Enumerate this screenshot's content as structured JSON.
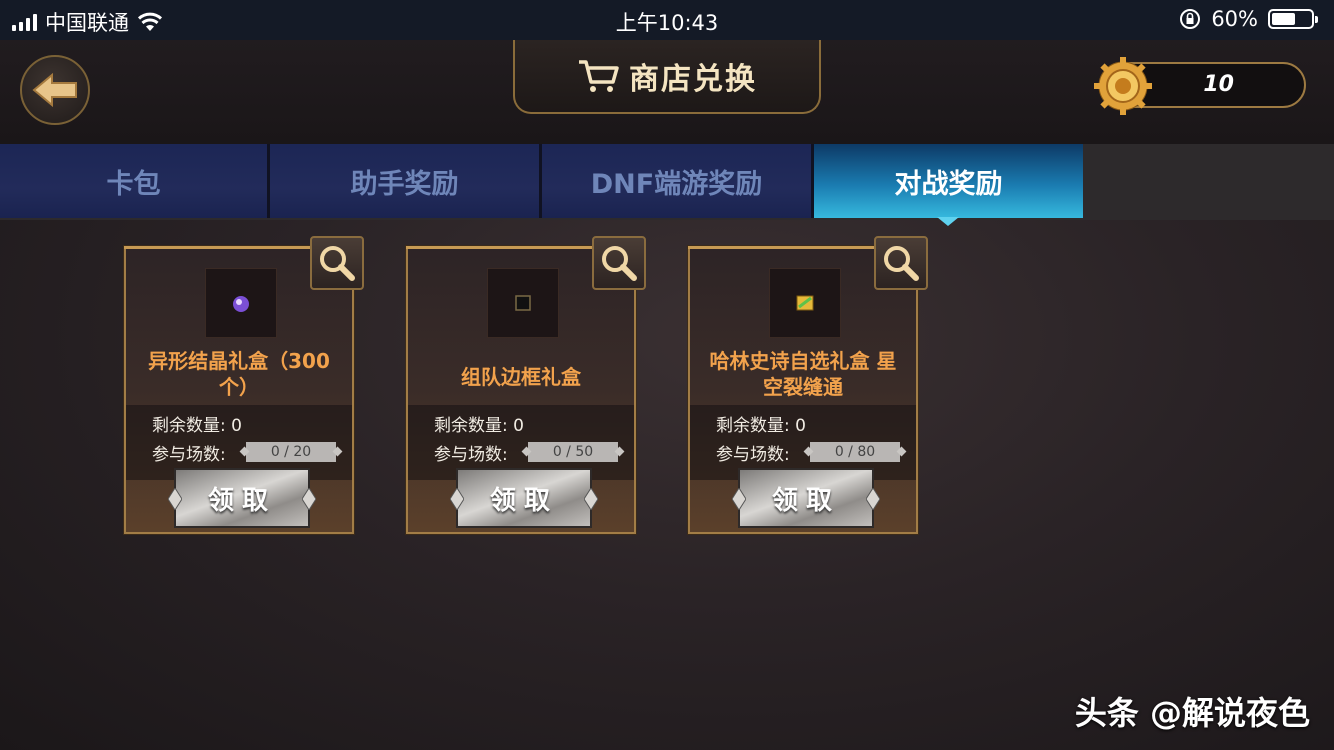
{
  "status_bar": {
    "carrier": "中国联通",
    "time": "上午10:43",
    "battery_percent": "60%",
    "battery_level": 0.6,
    "icons": [
      "signal-icon",
      "wifi-icon",
      "orientation-lock-icon",
      "battery-icon"
    ]
  },
  "header": {
    "title": "商店兑换",
    "currency_value": "10",
    "icons": [
      "back-arrow-icon",
      "cart-icon",
      "gear-coin-icon"
    ]
  },
  "tabs": [
    {
      "label": "卡包",
      "active": false
    },
    {
      "label": "助手奖励",
      "active": false
    },
    {
      "label": "DNF端游奖励",
      "active": false
    },
    {
      "label": "对战奖励",
      "active": true
    }
  ],
  "cards": [
    {
      "name": "异形结晶礼盒（300个）",
      "remaining_label": "剩余数量:",
      "remaining_value": "0",
      "matches_label": "参与场数:",
      "matches_progress": "0 / 20",
      "progress_fraction": 0,
      "claim_label": "领取",
      "item_icon": "crystal-icon"
    },
    {
      "name": "组队边框礼盒",
      "remaining_label": "剩余数量:",
      "remaining_value": "0",
      "matches_label": "参与场数:",
      "matches_progress": "0 / 50",
      "progress_fraction": 0,
      "claim_label": "领取",
      "item_icon": "frame-icon"
    },
    {
      "name": "哈林史诗自选礼盒 星空裂缝通",
      "remaining_label": "剩余数量:",
      "remaining_value": "0",
      "matches_label": "参与场数:",
      "matches_progress": "0 / 80",
      "progress_fraction": 0,
      "claim_label": "领取",
      "item_icon": "epic-box-icon"
    }
  ],
  "watermark": "头条 @解说夜色",
  "colors": {
    "accent_gold": "#c79a54",
    "item_name": "#f2a24c",
    "active_tab": "#1a7bb0",
    "inactive_tab": "#1c2655"
  }
}
